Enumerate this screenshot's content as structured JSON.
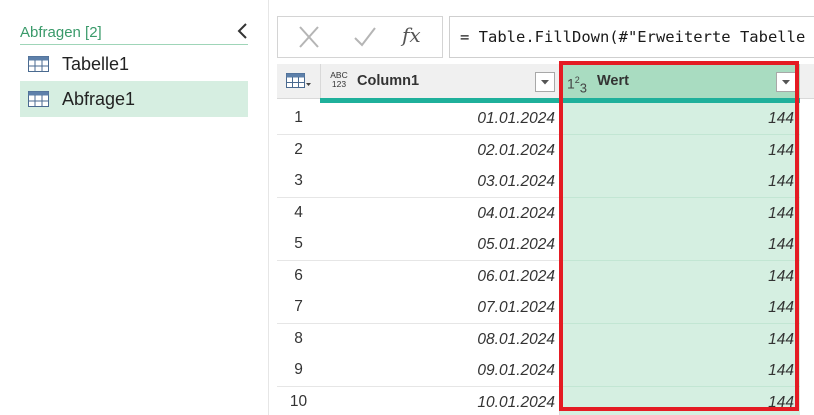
{
  "queries_pane": {
    "title": "Abfragen [2]",
    "items": [
      {
        "label": "Tabelle1",
        "icon": "table-icon",
        "selected": false
      },
      {
        "label": "Abfrage1",
        "icon": "table-icon",
        "selected": true
      }
    ]
  },
  "formula_bar": {
    "cancel_icon": "close-icon",
    "commit_icon": "checkmark-icon",
    "fx_label": "fx",
    "formula": "= Table.FillDown(#\"Erweiterte Tabelle"
  },
  "grid": {
    "columns": [
      {
        "type_badge": "ABC\n123",
        "title": "Column1"
      },
      {
        "type_badge": "1²3",
        "title": "Wert"
      }
    ],
    "rows": [
      {
        "num": "1",
        "column1": "01.01.2024",
        "wert": "144"
      },
      {
        "num": "2",
        "column1": "02.01.2024",
        "wert": "144"
      },
      {
        "num": "3",
        "column1": "03.01.2024",
        "wert": "144"
      },
      {
        "num": "4",
        "column1": "04.01.2024",
        "wert": "144"
      },
      {
        "num": "5",
        "column1": "05.01.2024",
        "wert": "144"
      },
      {
        "num": "6",
        "column1": "06.01.2024",
        "wert": "144"
      },
      {
        "num": "7",
        "column1": "07.01.2024",
        "wert": "144"
      },
      {
        "num": "8",
        "column1": "08.01.2024",
        "wert": "144"
      },
      {
        "num": "9",
        "column1": "09.01.2024",
        "wert": "144"
      },
      {
        "num": "10",
        "column1": "10.01.2024",
        "wert": "144"
      }
    ]
  },
  "colors": {
    "accent_green": "#3a9a6a",
    "selected_bg": "#d6eee1",
    "column_selected": "#a9dcc1",
    "cell_selected": "#d5efe1",
    "quality_bar": "#1fb09b",
    "highlight": "#e41b23"
  }
}
